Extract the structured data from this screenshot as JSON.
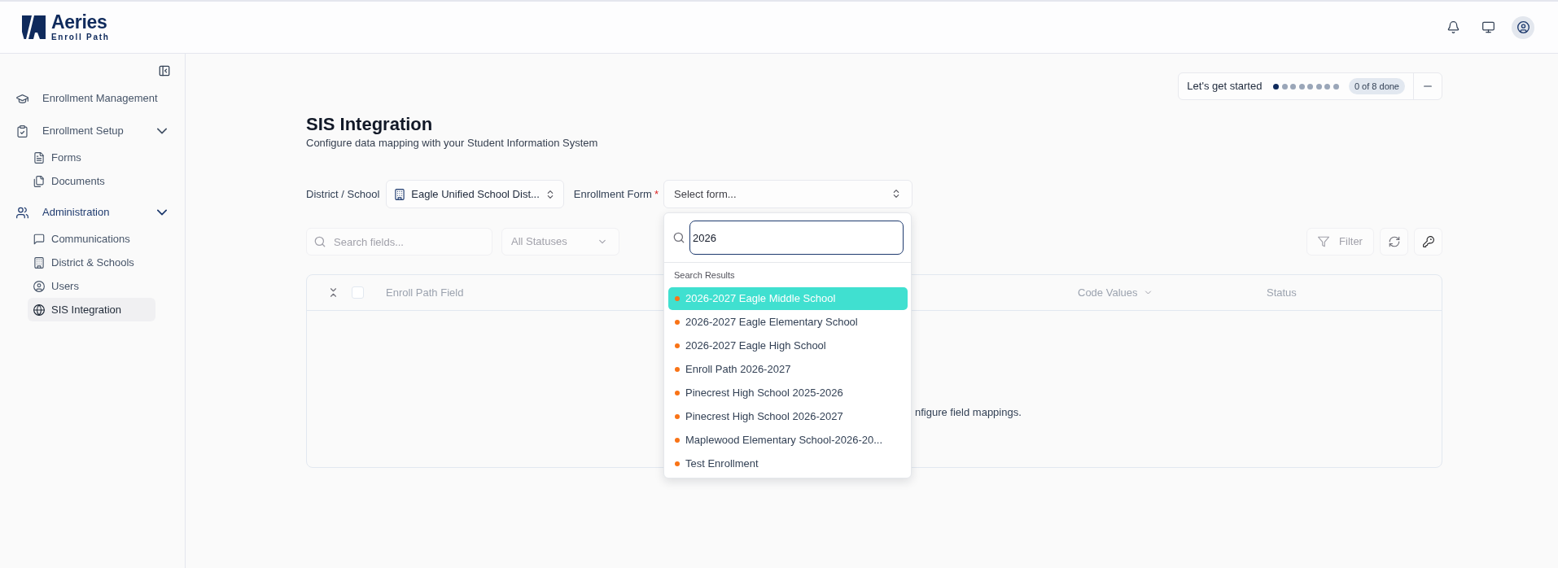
{
  "header": {
    "logo": {
      "name": "Aeries",
      "tagline": "Enroll Path"
    }
  },
  "sidebar": {
    "items": [
      {
        "label": "Enrollment Management",
        "kind": "link",
        "active": false
      },
      {
        "label": "Enrollment Setup",
        "kind": "group",
        "active": false,
        "expanded": true,
        "children": [
          {
            "label": "Forms",
            "selected": false
          },
          {
            "label": "Documents",
            "selected": false
          }
        ]
      },
      {
        "label": "Administration",
        "kind": "group",
        "active": true,
        "expanded": true,
        "children": [
          {
            "label": "Communications",
            "selected": false
          },
          {
            "label": "District & Schools",
            "selected": false
          },
          {
            "label": "Users",
            "selected": false
          },
          {
            "label": "SIS Integration",
            "selected": true
          }
        ]
      }
    ]
  },
  "onboarding": {
    "label": "Let's get started",
    "steps": [
      {
        "current": true
      },
      {
        "current": false
      },
      {
        "current": false
      },
      {
        "current": false
      },
      {
        "current": false
      },
      {
        "current": false
      },
      {
        "current": false
      },
      {
        "current": false
      }
    ],
    "count": "0 of 8 done"
  },
  "page": {
    "title": "SIS Integration",
    "subtitle": "Configure data mapping with your Student Information System"
  },
  "selectors": {
    "district": {
      "label": "District / School",
      "value": "Eagle Unified School Dist..."
    },
    "form": {
      "label": "Enrollment Form",
      "required_mark": "*",
      "placeholder": "Select form...",
      "open": true,
      "dropdown": {
        "search": {
          "value": "2026"
        },
        "section_label": "Search Results",
        "options": [
          {
            "label": "2026-2027 Eagle Middle School",
            "selected": true
          },
          {
            "label": "2026-2027 Eagle Elementary School",
            "selected": false
          },
          {
            "label": "2026-2027 Eagle High School",
            "selected": false
          },
          {
            "label": "Enroll Path 2026-2027",
            "selected": false
          },
          {
            "label": "Pinecrest High School 2025-2026",
            "selected": false
          },
          {
            "label": "Pinecrest High School 2026-2027",
            "selected": false
          },
          {
            "label": "Maplewood Elementary School-2026-20...",
            "selected": false
          },
          {
            "label": "Test Enrollment",
            "selected": false
          }
        ]
      }
    }
  },
  "toolbar": {
    "search": {
      "placeholder": "Search fields..."
    },
    "status": {
      "value": "All Statuses"
    },
    "filter_button": {
      "label": "Filter"
    }
  },
  "table": {
    "select_all": {
      "checked": false
    },
    "columns": [
      {
        "label": "Enroll Path Field",
        "kind": "plain"
      },
      {
        "label": "Code Values",
        "kind": "dropdown"
      },
      {
        "label": "Status",
        "kind": "plain"
      }
    ],
    "empty_message": "nfigure field mappings."
  }
}
